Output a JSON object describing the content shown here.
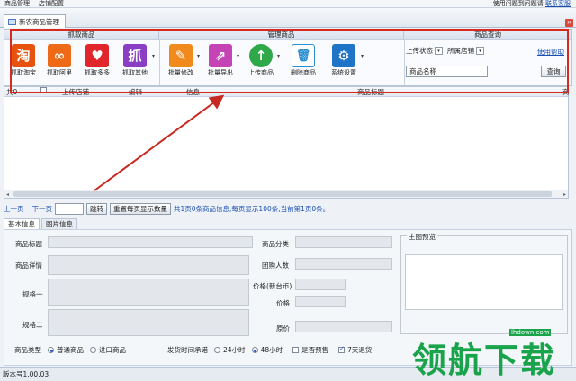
{
  "menubar": {
    "items": [
      "商品管理",
      "店铺配置"
    ],
    "status_text": "使用问题到问题请",
    "status_link": "联系客服"
  },
  "tab": {
    "label": "新农商品管理"
  },
  "ribbon": {
    "groups": {
      "grab": "抓取商品",
      "manage": "管理商品",
      "query": "商品查询"
    },
    "tools": [
      {
        "label": "抓取淘宝",
        "glyph": "淘",
        "color": "#e8520f"
      },
      {
        "label": "抓取阿里",
        "glyph": "∞",
        "color": "#ef6a16"
      },
      {
        "label": "抓取多多",
        "glyph": "♥",
        "color": "#e0262a"
      },
      {
        "label": "抓取其他",
        "glyph": "抓",
        "color": "#8a3ec4"
      },
      {
        "label": "批量修改",
        "glyph": "✎",
        "color": "#f08a1c"
      },
      {
        "label": "批量导出",
        "glyph": "⇗",
        "color": "#c643b5"
      },
      {
        "label": "上传商品",
        "glyph": "↑",
        "color": "#2fa84a"
      },
      {
        "label": "删除商品",
        "glyph": "🗑",
        "color": "#2a8fd0"
      },
      {
        "label": "系统设置",
        "glyph": "⚙",
        "color": "#2074c8"
      }
    ],
    "query": {
      "upload_status_label": "上传状态",
      "shop_label": "所属店铺",
      "help_link": "使用帮助",
      "name_placeholder": "商品名称",
      "search_button": "查询"
    }
  },
  "grid": {
    "columns": [
      "共0",
      "上传店铺",
      "编辑",
      "信息",
      "商品标题",
      "商"
    ],
    "rows": []
  },
  "pager": {
    "prev": "上一页",
    "next": "下一页",
    "jump": "跳转",
    "reset": "重置每页显示数量",
    "info": "共1页0条商品信息,每页显示100条,当前第1页0条。"
  },
  "sub_tabs": [
    "基本信息",
    "图片信息"
  ],
  "form": {
    "title_label": "商品标题",
    "detail_label": "商品详情",
    "spec1_label": "规格一",
    "spec2_label": "规格二",
    "category_label": "商品分类",
    "group_buy_label": "团购人数",
    "price_nt_label": "价格(新台币)",
    "price_label": "价格",
    "orig_price_label": "原价",
    "main_image_label": "主图预览",
    "type_label": "商品类型",
    "type_options": [
      "普通商品",
      "进口商品"
    ],
    "type_selected": 0,
    "ship_label": "发货时间承诺",
    "ship_options": [
      "24小时",
      "48小时"
    ],
    "ship_selected": 1,
    "presale_label": "是否预售",
    "presale_checked": false,
    "return_label": "7天退货",
    "return_checked": true
  },
  "statusbar": {
    "version": "版本号1.00.03"
  },
  "watermark": {
    "text": "领航下载",
    "url": "lhdown.com"
  }
}
